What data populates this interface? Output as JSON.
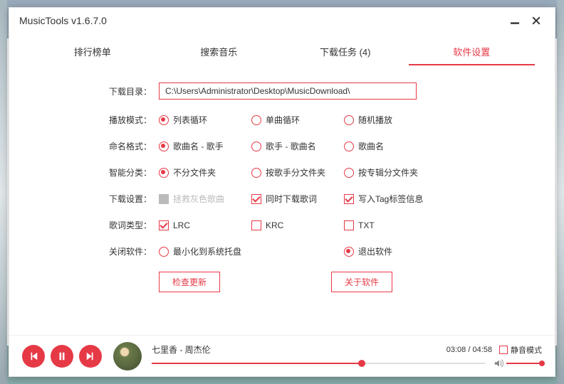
{
  "title": "MusicTools v1.6.7.0",
  "tabs": [
    {
      "label": "排行榜单"
    },
    {
      "label": "搜索音乐"
    },
    {
      "label": "下载任务 (4)"
    },
    {
      "label": "软件设置"
    }
  ],
  "settings": {
    "download_dir": {
      "label": "下载目录：",
      "value": "C:\\Users\\Administrator\\Desktop\\MusicDownload\\"
    },
    "play_mode": {
      "label": "播放模式：",
      "opts": [
        "列表循环",
        "单曲循环",
        "随机播放"
      ]
    },
    "naming": {
      "label": "命名格式：",
      "opts": [
        "歌曲名 - 歌手",
        "歌手 - 歌曲名",
        "歌曲名"
      ]
    },
    "smart_sort": {
      "label": "智能分类：",
      "opts": [
        "不分文件夹",
        "按歌手分文件夹",
        "按专辑分文件夹"
      ]
    },
    "dl_settings": {
      "label": "下载设置：",
      "opts": [
        "拯救灰色歌曲",
        "同时下载歌词",
        "写入Tag标签信息"
      ]
    },
    "lyric_type": {
      "label": "歌词类型：",
      "opts": [
        "LRC",
        "KRC",
        "TXT"
      ]
    },
    "close_action": {
      "label": "关闭软件：",
      "opts": [
        "最小化到系统托盘",
        "退出软件"
      ]
    },
    "btn_check": "检查更新",
    "btn_about": "关于软件"
  },
  "player": {
    "track": "七里香 - 周杰伦",
    "elapsed": "03:08",
    "total": "04:58",
    "mute_label": "静音模式"
  }
}
